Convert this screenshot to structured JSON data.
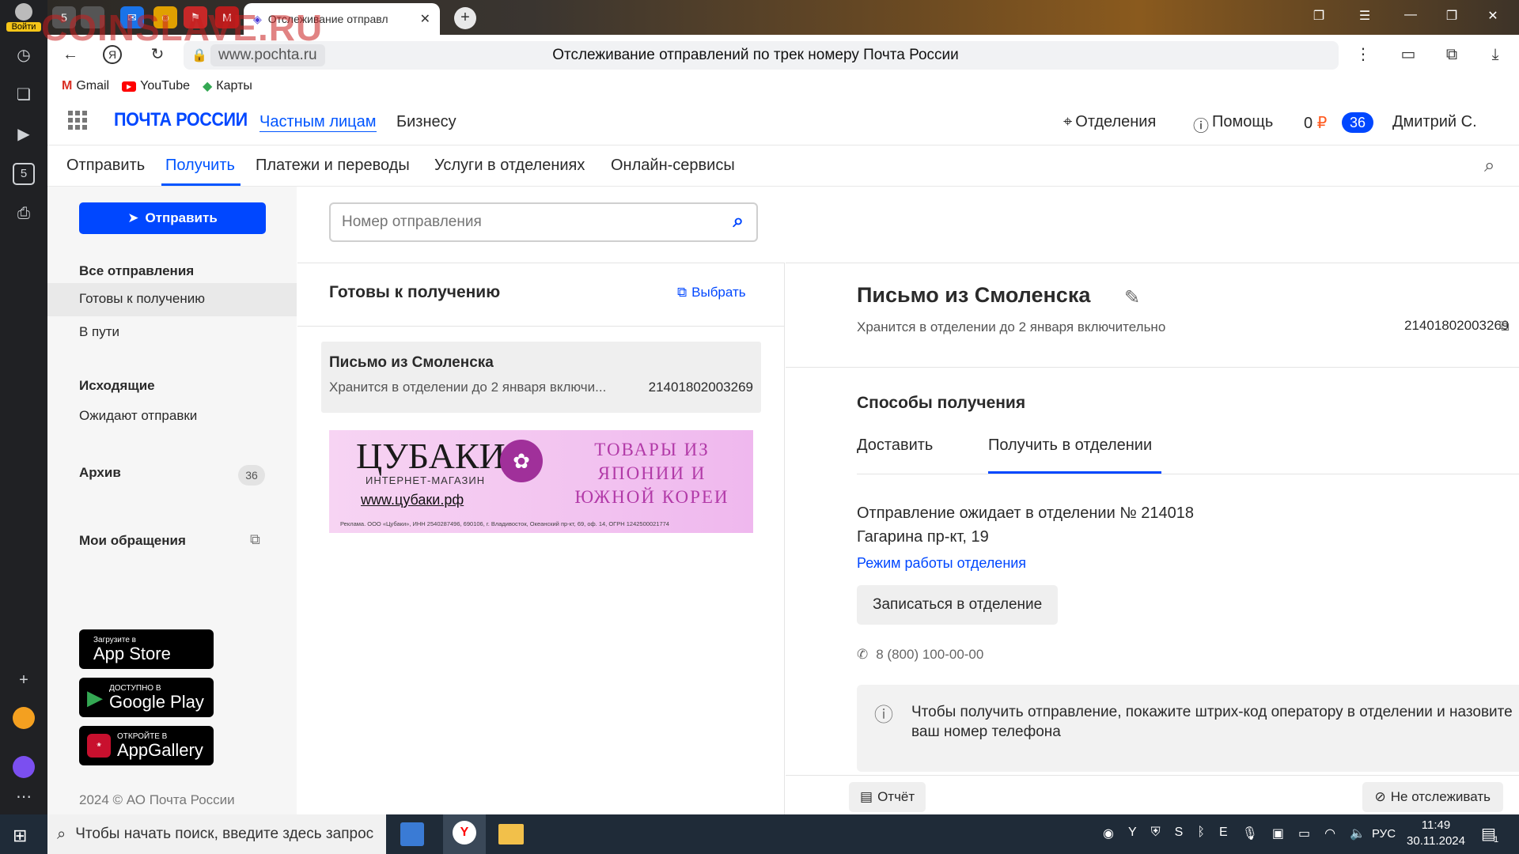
{
  "browser": {
    "profile_label": "Войти",
    "tab_badge": "5",
    "active_tab_title": "Отслеживание отправл",
    "url": "www.pochta.ru",
    "page_title": "Отслеживание отправлений по трек номеру Почта России",
    "bookmarks": [
      {
        "label": "Gmail",
        "icon": "gmail-icon"
      },
      {
        "label": "YouTube",
        "icon": "youtube-icon"
      },
      {
        "label": "Карты",
        "icon": "maps-icon"
      }
    ],
    "watermark": "COINSLAVE.RU",
    "sidebar_badge": "5"
  },
  "header": {
    "logo": "ПОЧТА РОССИИ",
    "segments": [
      "Частным лицам",
      "Бизнесу"
    ],
    "offices": "Отделения",
    "help": "Помощь",
    "points": "0",
    "notifications": "36",
    "user": "Дмитрий С."
  },
  "nav": [
    "Отправить",
    "Получить",
    "Платежи и переводы",
    "Услуги в отделениях",
    "Онлайн-сервисы"
  ],
  "sidebar": {
    "send_button": "Отправить",
    "sections": [
      {
        "title": "Все отправления",
        "items": [
          "Готовы к получению",
          "В пути"
        ]
      },
      {
        "title": "Исходящие",
        "items": [
          "Ожидают отправки"
        ]
      }
    ],
    "archive": "Архив",
    "archive_count": "36",
    "appeals": "Мои обращения",
    "stores": [
      {
        "small": "Загрузите в",
        "big": "App Store"
      },
      {
        "small": "ДОСТУПНО В",
        "big": "Google Play"
      },
      {
        "small": "ОТКРОЙТЕ В",
        "big": "AppGallery"
      }
    ],
    "copyright": "2024 © АО Почта России"
  },
  "search": {
    "placeholder": "Номер отправления"
  },
  "list": {
    "title": "Готовы к получению",
    "select": "Выбрать",
    "items": [
      {
        "title": "Письмо из Смоленска",
        "status": "Хранится в отделении до 2 января включи...",
        "track": "21401802003269"
      }
    ]
  },
  "ad": {
    "brand": "ЦУБАКИ",
    "brand_sub": "ИНТЕРНЕТ-МАГАЗИН",
    "site": "www.цубаки.рф",
    "slogan": "ТОВАРЫ ИЗ ЯПОНИИ И ЮЖНОЙ КОРЕИ",
    "legal": "Реклама. ООО «Цубаки», ИНН 2540287496, 690106, г. Владивосток, Океанский пр-кт, 69, оф. 14, ОГРН 1242500021774"
  },
  "detail": {
    "title": "Письмо из Смоленска",
    "status": "Хранится в отделении до 2 января включительно",
    "track": "21401802003269",
    "methods_title": "Способы получения",
    "tabs": [
      "Доставить",
      "Получить в отделении"
    ],
    "office_line": "Отправление ожидает в отделении № 214018",
    "address": "Гагарина пр-кт, 19",
    "hours_link": "Режим работы отделения",
    "book_button": "Записаться в отделение",
    "phone": "8 (800) 100-00-00",
    "info": "Чтобы получить отправление, покажите штрих-код оператору в отделении и назовите ваш номер телефона",
    "report_button": "Отчёт",
    "untrack_button": "Не отслеживать"
  },
  "taskbar": {
    "search_placeholder": "Чтобы начать поиск, введите здесь запрос",
    "lang": "РУС",
    "time": "11:49",
    "date": "30.11.2024",
    "notif_count": "1"
  }
}
